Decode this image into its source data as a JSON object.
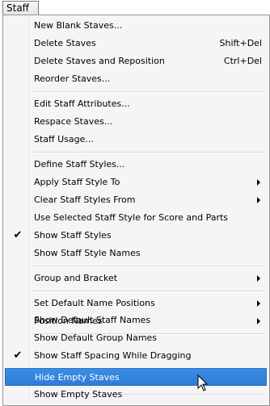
{
  "menubar": {
    "title": "Staff"
  },
  "menu": {
    "items": [
      {
        "label": "New Blank Staves..."
      },
      {
        "label": "Delete Staves",
        "shortcut": "Shift+Del"
      },
      {
        "label": "Delete Staves and Reposition",
        "shortcut": "Ctrl+Del"
      },
      {
        "label": "Reorder Staves..."
      },
      {
        "label": "Edit Staff Attributes..."
      },
      {
        "label": "Respace Staves..."
      },
      {
        "label": "Staff Usage..."
      },
      {
        "label": "Define Staff Styles..."
      },
      {
        "label": "Apply Staff Style To"
      },
      {
        "label": "Clear Staff Styles From"
      },
      {
        "label": "Use Selected Staff Style for Score and Parts"
      },
      {
        "label": "Show Staff Styles",
        "checked": true
      },
      {
        "label": "Show Staff Style Names"
      },
      {
        "label": "Group and Bracket"
      },
      {
        "label": "Set Default Name Positions"
      },
      {
        "label": "Position Names"
      },
      {
        "label": "Show Default Staff Names"
      },
      {
        "label": "Show Default Group Names"
      },
      {
        "label": "Show Staff Spacing While Dragging",
        "checked": true
      },
      {
        "label": "Hide Empty Staves",
        "highlighted": true
      },
      {
        "label": "Show Empty Staves"
      }
    ],
    "check_glyph": "✔"
  },
  "colors": {
    "highlight": "#3b8fe4",
    "menu_bg": "#f5f5f5"
  },
  "icons": {
    "submenu": "submenu-arrow-icon",
    "cursor": "mouse-pointer-icon"
  }
}
